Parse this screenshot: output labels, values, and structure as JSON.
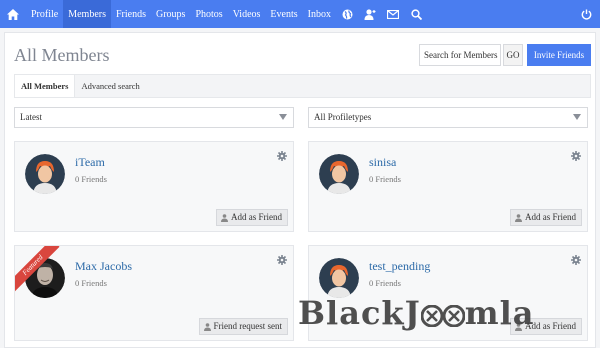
{
  "nav": {
    "items": [
      {
        "label": "Profile",
        "active": false
      },
      {
        "label": "Members",
        "active": true
      },
      {
        "label": "Friends",
        "active": false
      },
      {
        "label": "Groups",
        "active": false
      },
      {
        "label": "Photos",
        "active": false
      },
      {
        "label": "Videos",
        "active": false
      },
      {
        "label": "Events",
        "active": false
      },
      {
        "label": "Inbox",
        "active": false
      }
    ],
    "icons": [
      "home-icon",
      "globe-icon",
      "user-add-icon",
      "envelope-icon",
      "search-icon",
      "power-icon"
    ]
  },
  "page": {
    "title": "All Members",
    "search_placeholder": "Search for Members",
    "go_label": "GO",
    "invite_label": "Invite Friends"
  },
  "tabs": [
    {
      "label": "All Members",
      "active": true
    },
    {
      "label": "Advanced search",
      "active": false
    }
  ],
  "filters": {
    "sort": "Latest",
    "profiletype": "All Profiletypes"
  },
  "members": [
    {
      "name": "iTeam",
      "friends": "0 Friends",
      "action": "Add as Friend",
      "featured": false,
      "avatar": "default-avatar"
    },
    {
      "name": "sinisa",
      "friends": "0 Friends",
      "action": "Add as Friend",
      "featured": false,
      "avatar": "default-avatar"
    },
    {
      "name": "Max Jacobs",
      "friends": "0 Friends",
      "action": "Friend request sent",
      "featured": true,
      "featured_label": "Featured",
      "avatar": "photo-avatar"
    },
    {
      "name": "test_pending",
      "friends": "0 Friends",
      "action": "Add as Friend",
      "featured": false,
      "avatar": "default-avatar"
    }
  ],
  "watermark": "BlackJoomla",
  "colors": {
    "brand": "#4a7df0",
    "link": "#2c6aa8",
    "ribbon": "#d9463e"
  }
}
